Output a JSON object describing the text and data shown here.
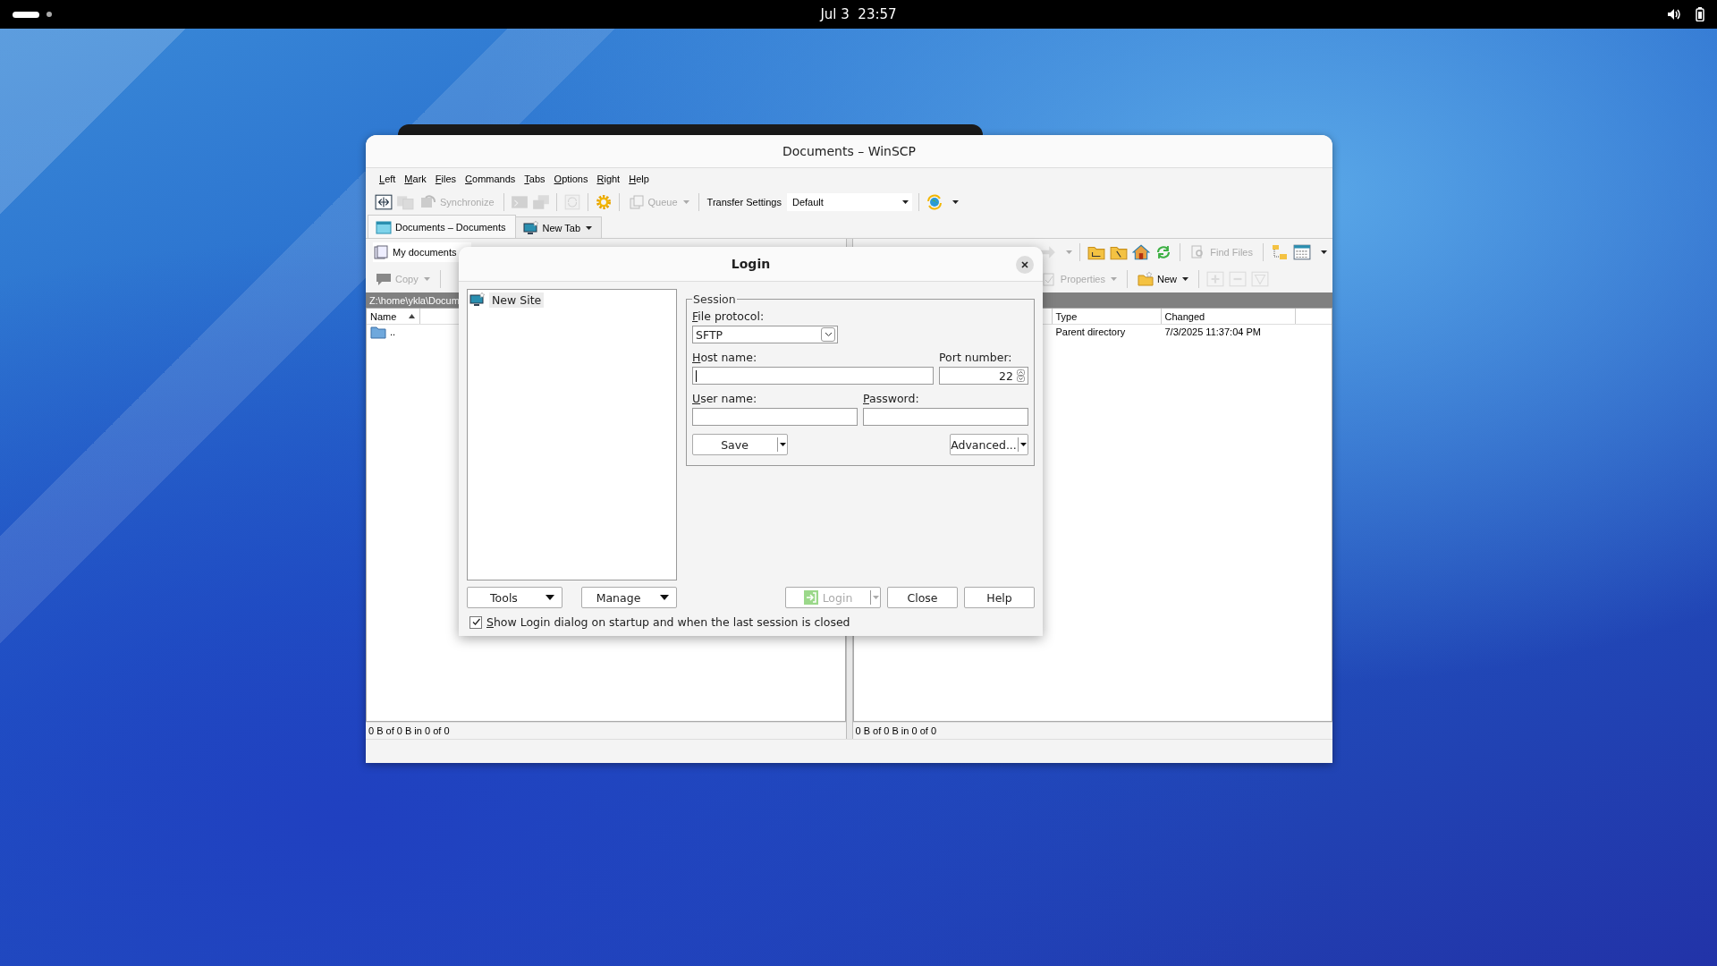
{
  "top_bar": {
    "clock": "Jul 3  23:57"
  },
  "window": {
    "title": "Documents – WinSCP"
  },
  "menu": [
    {
      "label": "Left"
    },
    {
      "label": "Mark"
    },
    {
      "label": "Files"
    },
    {
      "label": "Commands"
    },
    {
      "label": "Tabs"
    },
    {
      "label": "Options"
    },
    {
      "label": "Right"
    },
    {
      "label": "Help"
    }
  ],
  "toolbar": {
    "synchronize": {
      "label": "Synchronize",
      "disabled": true
    },
    "queue": {
      "label": "Queue",
      "disabled": true
    },
    "transfer_settings": "Transfer Settings",
    "transfer_preset": "Default"
  },
  "tabs": [
    {
      "label": "Documents – Documents",
      "selected": true
    },
    {
      "label": "New Tab",
      "selected": false
    }
  ],
  "left_panel": {
    "location": "My documents",
    "copy": {
      "label": "Copy",
      "disabled": true
    },
    "path": "Z:\\home\\ykla\\Docum",
    "columns": [
      "Name"
    ],
    "rows": [
      {
        "name": ".."
      }
    ],
    "status": "0 B of 0 B in 0 of 0"
  },
  "right_panel": {
    "find_files": {
      "label": "Find Files",
      "disabled": true
    },
    "properties": {
      "label": "Properties",
      "disabled": true
    },
    "new": "New",
    "columns": [
      "Type",
      "Changed"
    ],
    "rows": [
      {
        "type": "Parent directory",
        "changed": "7/3/2025 11:37:04 PM"
      }
    ],
    "status": "0 B of 0 B in 0 of 0"
  },
  "dialog": {
    "title": "Login",
    "sites": [
      {
        "label": "New Site",
        "selected": true
      }
    ],
    "session_group": "Session",
    "file_protocol": {
      "label": "File protocol:",
      "value": "SFTP"
    },
    "host": {
      "label": "Host name:",
      "focused": true
    },
    "port": {
      "label": "Port number:",
      "value": "22"
    },
    "user": {
      "label": "User name:"
    },
    "password": {
      "label": "Password:"
    },
    "save": "Save",
    "advanced": "Advanced...",
    "tools": "Tools",
    "manage": "Manage",
    "login": {
      "label": "Login",
      "disabled": true
    },
    "close": "Close",
    "help": "Help",
    "show_on_startup": {
      "label": "Show Login dialog on startup and when the last session is closed",
      "checked": true
    }
  }
}
